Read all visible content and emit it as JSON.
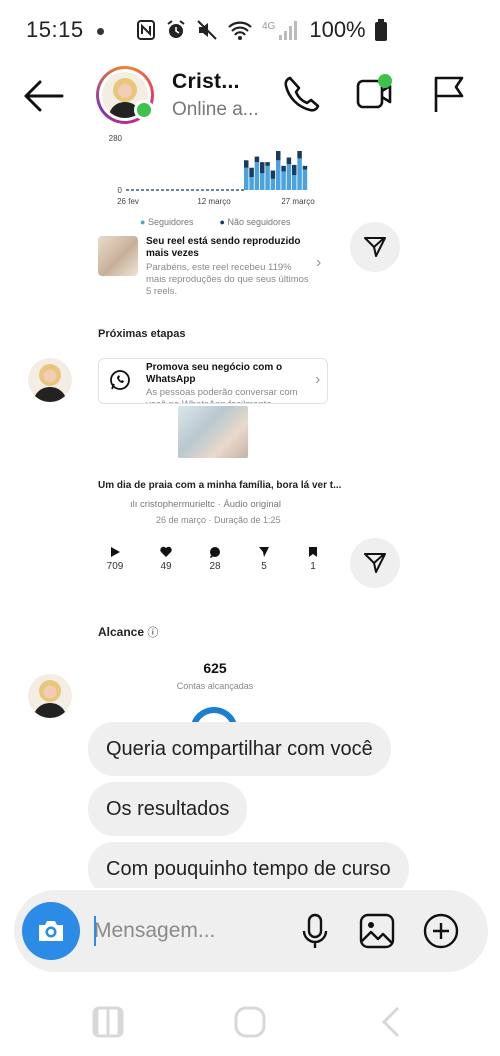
{
  "status_bar": {
    "time": "15:15",
    "network": "4G",
    "battery": "100%"
  },
  "header": {
    "contact_name": "Crist...",
    "contact_status": "Online a..."
  },
  "chart_data": {
    "type": "bar",
    "y_ticks": [
      "280",
      "0"
    ],
    "x_ticks": [
      "26 fev",
      "12 março",
      "27 março"
    ],
    "legend": [
      "Seguidores",
      "Não seguidores"
    ],
    "colors": {
      "followers": "#4aa3df",
      "non_followers": "#1b3a5c"
    },
    "series": [
      {
        "name": "Seguidores",
        "values": [
          120,
          70,
          150,
          90,
          130,
          60,
          160,
          100,
          140,
          80,
          170,
          110
        ]
      },
      {
        "name": "Não seguidores",
        "values": [
          40,
          50,
          30,
          60,
          20,
          45,
          50,
          30,
          35,
          55,
          40,
          20
        ]
      }
    ],
    "ylim": [
      0,
      280
    ]
  },
  "insight": {
    "title": "Seu reel está sendo reproduzido mais vezes",
    "body": "Parabéns, este reel recebeu 119% mais reproduções do que seus últimos 5 reels."
  },
  "next_steps": {
    "title": "Próximas etapas",
    "item_title": "Promova seu negócio com o WhatsApp",
    "item_body": "As pessoas poderão conversar com você no WhatsApp facilmente"
  },
  "reel": {
    "caption": "Um dia de praia com a minha família, bora lá ver t...",
    "author": "cristophermurieltc · Áudio original",
    "meta": "26 de março · Duração de 1:25",
    "stats": [
      {
        "icon": "play-icon",
        "value": "709"
      },
      {
        "icon": "heart-icon",
        "value": "49"
      },
      {
        "icon": "comment-icon",
        "value": "28"
      },
      {
        "icon": "send-icon",
        "value": "5"
      },
      {
        "icon": "bookmark-icon",
        "value": "1"
      }
    ]
  },
  "reach": {
    "title": "Alcance",
    "value": "625",
    "label": "Contas alcançadas"
  },
  "messages": [
    "Queria compartilhar com você",
    "Os resultados",
    "Com pouquinho tempo de curso"
  ],
  "composer": {
    "placeholder": "Mensagem..."
  },
  "colors": {
    "accent": "#2b8be6",
    "online": "#3ec34a",
    "bubble": "#efefef"
  }
}
